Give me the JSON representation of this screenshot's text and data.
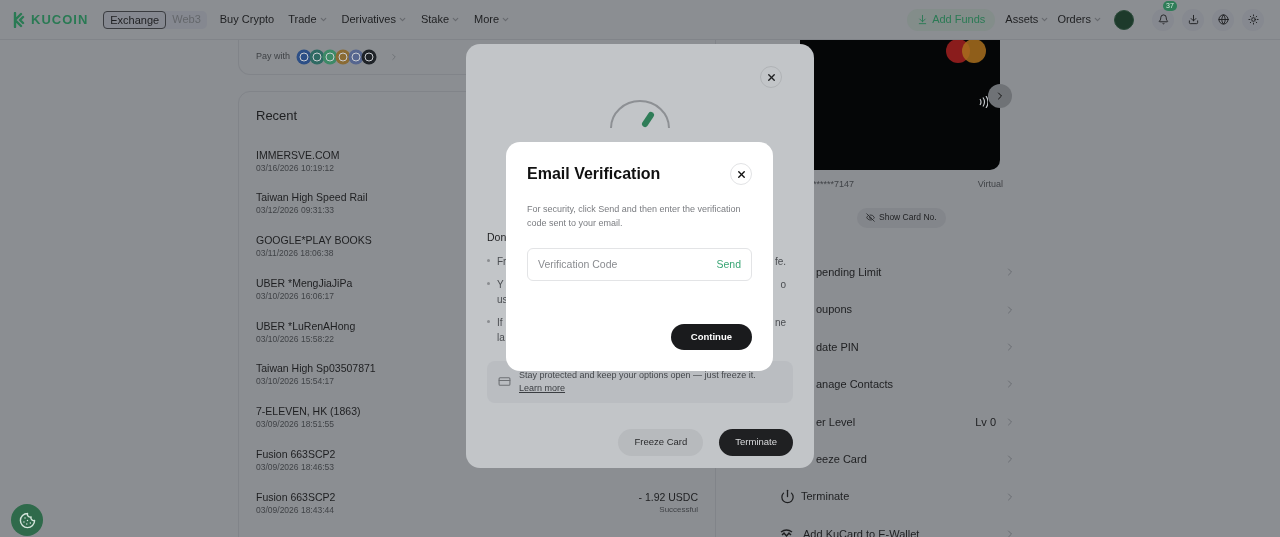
{
  "header": {
    "logo": "KUCOIN",
    "mode_tabs": [
      {
        "label": "Exchange",
        "selected": true
      },
      {
        "label": "Web3",
        "selected": false
      }
    ],
    "nav": [
      {
        "label": "Buy Crypto",
        "dropdown": false
      },
      {
        "label": "Trade",
        "dropdown": true
      },
      {
        "label": "Derivatives",
        "dropdown": true
      },
      {
        "label": "Stake",
        "dropdown": true
      },
      {
        "label": "More",
        "dropdown": true
      }
    ],
    "add_funds": "Add Funds",
    "menus": [
      {
        "label": "Assets",
        "dropdown": true
      },
      {
        "label": "Orders",
        "dropdown": true
      }
    ],
    "notification_count": "37"
  },
  "pay_with": {
    "label": "Pay with"
  },
  "recent": {
    "title": "Recent",
    "transactions": [
      {
        "merchant": "IMMERSVE.COM",
        "time": "03/16/2026 10:19:12"
      },
      {
        "merchant": "Taiwan High Speed Rail",
        "time": "03/12/2026 09:31:33"
      },
      {
        "merchant": "GOOGLE*PLAY BOOKS",
        "time": "03/11/2026 18:06:38"
      },
      {
        "merchant": "UBER *MengJiaJiPa",
        "time": "03/10/2026 16:06:17"
      },
      {
        "merchant": "UBER *LuRenAHong",
        "time": "03/10/2026 15:58:22"
      },
      {
        "merchant": "Taiwan High Sp03507871",
        "time": "03/10/2026 15:54:17"
      },
      {
        "merchant": "7-ELEVEN, HK (1863)",
        "time": "03/09/2026 18:51:55"
      },
      {
        "merchant": "Fusion 663SCP2",
        "time": "03/09/2026 18:46:53"
      },
      {
        "merchant": "Fusion 663SCP2",
        "time": "03/09/2026 18:43:44",
        "amount": "- 1.92 USDC",
        "status": "Successful"
      }
    ]
  },
  "card": {
    "number": "******7147",
    "type": "Virtual",
    "show_button": "Show Card No."
  },
  "card_menu": [
    {
      "label": "pending Limit",
      "kind": "text"
    },
    {
      "label": "oupons",
      "kind": "text"
    },
    {
      "label": "date PIN",
      "kind": "text"
    },
    {
      "label": "anage Contacts",
      "kind": "text"
    },
    {
      "label": "er Level",
      "value": "Lv 0",
      "kind": "text"
    },
    {
      "label": "eeze Card",
      "kind": "text"
    },
    {
      "label": "Terminate",
      "kind": "with_icon"
    },
    {
      "label": "Add KuCard to E-Wallet",
      "kind": "with_icon"
    }
  ],
  "terminate_dialog": {
    "heading": "Don",
    "bullets": [
      {
        "start": [
          "Fr"
        ],
        "end": "fe."
      },
      {
        "start": [
          "Y",
          "us"
        ],
        "end": "o"
      },
      {
        "start": [
          "If",
          "la"
        ],
        "end": "ne"
      }
    ],
    "info": "Stay protected and keep your options open — just freeze it.",
    "info_link": "Learn more",
    "buttons": [
      {
        "label": "Freeze Card",
        "kind": "secondary"
      },
      {
        "label": "Terminate",
        "kind": "primary"
      }
    ]
  },
  "email_dialog": {
    "title": "Email Verification",
    "description": "For security, click Send and then enter the verification code sent to your email.",
    "field": {
      "placeholder": "Verification Code"
    },
    "send": "Send",
    "continue": "Continue"
  }
}
